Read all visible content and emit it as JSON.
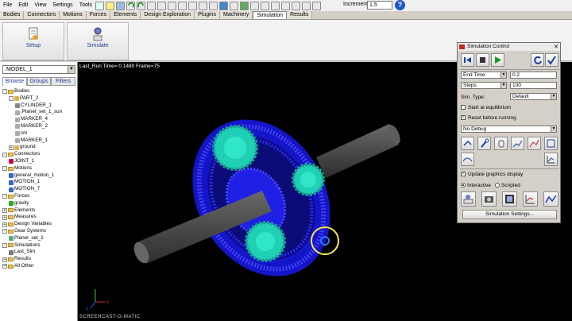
{
  "menu": [
    "File",
    "Edit",
    "View",
    "Settings",
    "Tools"
  ],
  "toolbar": {
    "increment_label": "Increment",
    "increment_value": "1.5"
  },
  "tabs": [
    "Bodies",
    "Connectors",
    "Motions",
    "Forces",
    "Elements",
    "Design Exploration",
    "Plugins",
    "Machinery",
    "Simulation",
    "Results"
  ],
  "active_tab": "Simulation",
  "ribbon": {
    "setup": "Setup",
    "simulate": "Simulate"
  },
  "left": {
    "model": ".MODEL_1",
    "panel_tabs": [
      "Browse",
      "Groups",
      "Filters"
    ],
    "tree": [
      {
        "label": "Bodies",
        "depth": 0,
        "exp": "-",
        "icon": "folder"
      },
      {
        "label": "PART_2",
        "depth": 1,
        "exp": "-",
        "icon": "part"
      },
      {
        "label": "CYLINDER_1",
        "depth": 2,
        "exp": "",
        "icon": "cylinder"
      },
      {
        "label": ".Planet_set_1_sun",
        "depth": 2,
        "exp": "",
        "icon": "marker"
      },
      {
        "label": "MARKER_4",
        "depth": 2,
        "exp": "",
        "icon": "marker"
      },
      {
        "label": "MARKER_2",
        "depth": 2,
        "exp": "",
        "icon": "marker"
      },
      {
        "label": "cm",
        "depth": 2,
        "exp": "",
        "icon": "marker"
      },
      {
        "label": "MARKER_1",
        "depth": 2,
        "exp": "",
        "icon": "marker"
      },
      {
        "label": "ground",
        "depth": 1,
        "exp": "+",
        "icon": "part"
      },
      {
        "label": "Connectors",
        "depth": 0,
        "exp": "-",
        "icon": "folder"
      },
      {
        "label": "JOINT_1",
        "depth": 1,
        "exp": "",
        "icon": "joint"
      },
      {
        "label": "Motions",
        "depth": 0,
        "exp": "-",
        "icon": "folder"
      },
      {
        "label": "general_motion_1",
        "depth": 1,
        "exp": "",
        "icon": "motion"
      },
      {
        "label": "MOTION_1",
        "depth": 1,
        "exp": "",
        "icon": "motion"
      },
      {
        "label": "MOTION_7",
        "depth": 1,
        "exp": "",
        "icon": "motion"
      },
      {
        "label": "Forces",
        "depth": 0,
        "exp": "-",
        "icon": "folder"
      },
      {
        "label": "gravity",
        "depth": 1,
        "exp": "",
        "icon": "gravity"
      },
      {
        "label": "Elements",
        "depth": 0,
        "exp": "+",
        "icon": "folder"
      },
      {
        "label": "Measures",
        "depth": 0,
        "exp": "+",
        "icon": "folder"
      },
      {
        "label": "Design Variables",
        "depth": 0,
        "exp": "+",
        "icon": "folder"
      },
      {
        "label": "Gear Systems",
        "depth": 0,
        "exp": "-",
        "icon": "folder"
      },
      {
        "label": "Planet_set_1",
        "depth": 1,
        "exp": "",
        "icon": "gear"
      },
      {
        "label": "Simulations",
        "depth": 0,
        "exp": "-",
        "icon": "folder"
      },
      {
        "label": "Last_Sim",
        "depth": 1,
        "exp": "",
        "icon": "sim"
      },
      {
        "label": "Results",
        "depth": 0,
        "exp": "+",
        "icon": "folder"
      },
      {
        "label": "All Other",
        "depth": 0,
        "exp": "+",
        "icon": "folder"
      }
    ]
  },
  "viewport": {
    "status": "Last_Run   Time=  0.1480  Frame=75",
    "watermark": "SCREENCAST-O-MATIC",
    "axis_x": "x",
    "axis_z": "z"
  },
  "sim_control": {
    "title": "Simulation Control",
    "end_mode": "End Time",
    "end_value": "0.2",
    "steps_mode": "Steps",
    "steps_value": "100",
    "sim_type_label": "Sim. Type:",
    "sim_type": "Default",
    "start_eq": "Start at equilibrium",
    "reset": "Reset before running",
    "debug": "No Debug",
    "update_graphics": "Update graphics display",
    "interactive": "Interactive",
    "scripted": "Scripted",
    "settings_btn": "Simulation Settings..."
  },
  "colors": {
    "gear_blue": "#1a1ad8",
    "planet_cyan": "#22d6b8",
    "shaft": "#4e4e4e",
    "background": "#000000"
  }
}
